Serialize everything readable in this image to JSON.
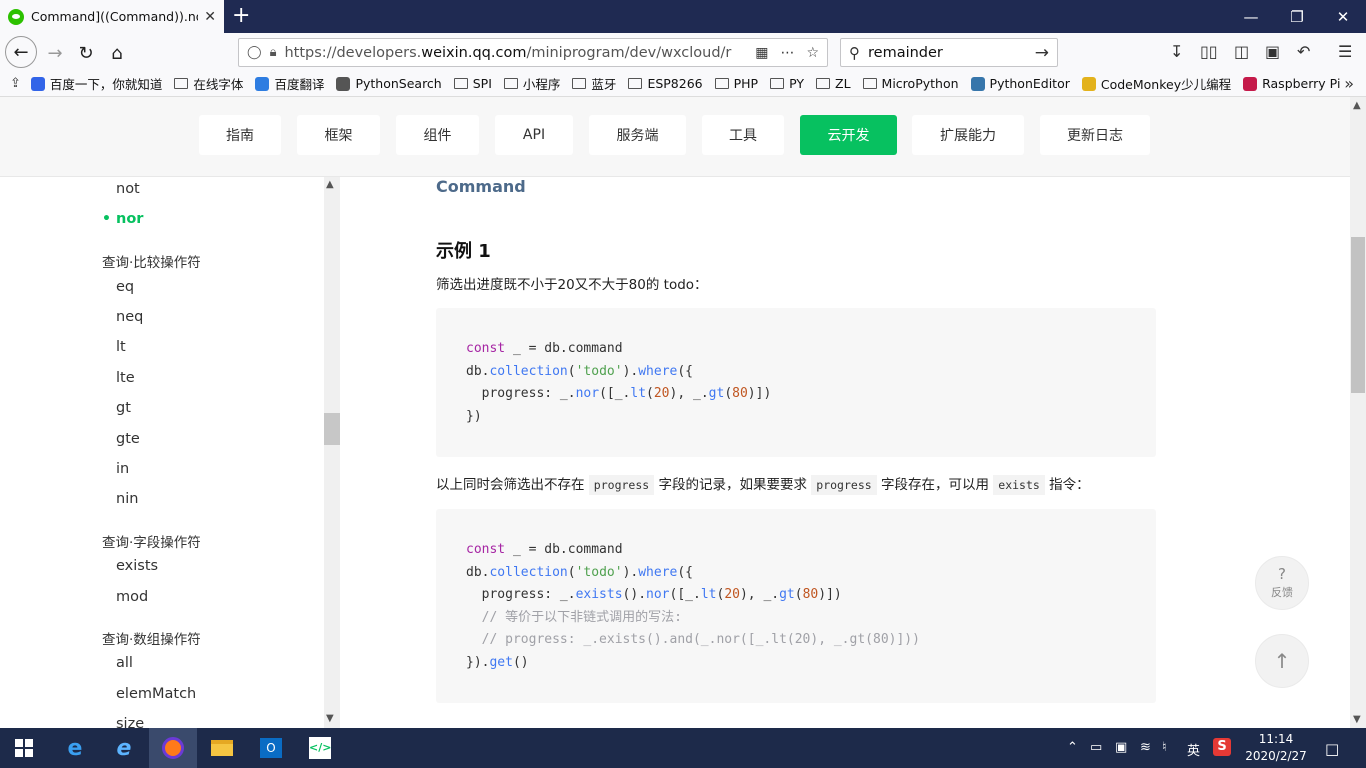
{
  "browser": {
    "tab_title": "Command]((Command)).nor",
    "tab_close": "✕",
    "new_tab": "+",
    "url_prefix": "https://developers.",
    "url_domain": "weixin.qq.com",
    "url_path": "/miniprogram/dev/wxcloud/r",
    "search_value": "remainder",
    "colors": {
      "tabbar": "#1f2a52",
      "toolbar": "#f9f9fb"
    }
  },
  "bookmarks": [
    {
      "label": "百度一下，你就知道",
      "icon": "baidu-icon"
    },
    {
      "label": "在线字体",
      "icon": "folder-icon"
    },
    {
      "label": "百度翻译",
      "icon": "translate-icon"
    },
    {
      "label": "PythonSearch",
      "icon": "globe-icon"
    },
    {
      "label": "SPI",
      "icon": "folder-icon"
    },
    {
      "label": "小程序",
      "icon": "folder-icon"
    },
    {
      "label": "蓝牙",
      "icon": "folder-icon"
    },
    {
      "label": "ESP8266",
      "icon": "folder-icon"
    },
    {
      "label": "PHP",
      "icon": "folder-icon"
    },
    {
      "label": "PY",
      "icon": "folder-icon"
    },
    {
      "label": "ZL",
      "icon": "folder-icon"
    },
    {
      "label": "MicroPython",
      "icon": "folder-icon"
    },
    {
      "label": "PythonEditor",
      "icon": "python-icon"
    },
    {
      "label": "CodeMonkey少儿编程",
      "icon": "banana-icon"
    },
    {
      "label": "Raspberry Pi",
      "icon": "raspberry-icon"
    }
  ],
  "topnav": {
    "tabs": [
      "指南",
      "框架",
      "组件",
      "API",
      "服务端",
      "工具",
      "云开发",
      "扩展能力",
      "更新日志"
    ],
    "active_index": 6,
    "accent": "#07c160"
  },
  "sidebar": {
    "items": [
      {
        "label": "not"
      },
      {
        "label": "nor",
        "active": true
      },
      {
        "group": "查询·比较操作符"
      },
      {
        "label": "eq"
      },
      {
        "label": "neq"
      },
      {
        "label": "lt"
      },
      {
        "label": "lte"
      },
      {
        "label": "gt"
      },
      {
        "label": "gte"
      },
      {
        "label": "in"
      },
      {
        "label": "nin"
      },
      {
        "group": "查询·字段操作符"
      },
      {
        "label": "exists"
      },
      {
        "label": "mod"
      },
      {
        "group": "查询·数组操作符"
      },
      {
        "label": "all"
      },
      {
        "label": "elemMatch"
      },
      {
        "label": "size"
      }
    ],
    "bullet": "•"
  },
  "content": {
    "heading_command": "Command",
    "heading_example": "示例 1",
    "para1": "筛选出进度既不小于20又不大于80的 todo：",
    "para2_a": "以上同时会筛选出不存在",
    "para2_code1": "progress",
    "para2_b": "字段的记录，如果要要求",
    "para2_code2": "progress",
    "para2_c": "字段存在，可以用",
    "para2_code3": "exists",
    "para2_d": "指令：",
    "code1": [
      [
        [
          "kw",
          "const"
        ],
        [
          "p",
          " _ = db.command"
        ]
      ],
      [
        [
          "p",
          "db."
        ],
        [
          "fn",
          "collection"
        ],
        [
          "p",
          "("
        ],
        [
          "st",
          "'todo'"
        ],
        [
          "p",
          ")."
        ],
        [
          "fn",
          "where"
        ],
        [
          "p",
          "({"
        ]
      ],
      [
        [
          "p",
          "  progress: _."
        ],
        [
          "fn",
          "nor"
        ],
        [
          "p",
          "([_."
        ],
        [
          "fn",
          "lt"
        ],
        [
          "p",
          "("
        ],
        [
          "nm",
          "20"
        ],
        [
          "p",
          "), _."
        ],
        [
          "fn",
          "gt"
        ],
        [
          "p",
          "("
        ],
        [
          "nm",
          "80"
        ],
        [
          "p",
          ")])"
        ]
      ],
      [
        [
          "p",
          "})"
        ]
      ]
    ],
    "code2": [
      [
        [
          "kw",
          "const"
        ],
        [
          "p",
          " _ = db.command"
        ]
      ],
      [
        [
          "p",
          "db."
        ],
        [
          "fn",
          "collection"
        ],
        [
          "p",
          "("
        ],
        [
          "st",
          "'todo'"
        ],
        [
          "p",
          ")."
        ],
        [
          "fn",
          "where"
        ],
        [
          "p",
          "({"
        ]
      ],
      [
        [
          "p",
          "  progress: _."
        ],
        [
          "fn",
          "exists"
        ],
        [
          "p",
          "()."
        ],
        [
          "fn",
          "nor"
        ],
        [
          "p",
          "([_."
        ],
        [
          "fn",
          "lt"
        ],
        [
          "p",
          "("
        ],
        [
          "nm",
          "20"
        ],
        [
          "p",
          "), _."
        ],
        [
          "fn",
          "gt"
        ],
        [
          "p",
          "("
        ],
        [
          "nm",
          "80"
        ],
        [
          "p",
          ")])"
        ]
      ],
      [
        [
          "cm",
          "  // 等价于以下非链式调用的写法:"
        ]
      ],
      [
        [
          "cm",
          "  // progress: _.exists().and(_.nor([_.lt(20), _.gt(80)]))"
        ]
      ],
      [
        [
          "p",
          "})."
        ],
        [
          "fn",
          "get"
        ],
        [
          "p",
          "()"
        ]
      ]
    ],
    "code_colors": {
      "keyword": "#a626a4",
      "function": "#4078f2",
      "string": "#50a14f",
      "number": "#c05621",
      "comment": "#a0a1a7"
    }
  },
  "floating": {
    "feedback_icon": "?",
    "feedback_label": "反馈",
    "top_icon": "↑"
  },
  "taskbar": {
    "ime": "英",
    "time": "11:14",
    "date": "2020/2/27",
    "apps": [
      "start-icon",
      "edge-icon",
      "ie-icon",
      "firefox-icon",
      "explorer-icon",
      "outlook-icon",
      "code-editor-icon"
    ]
  }
}
